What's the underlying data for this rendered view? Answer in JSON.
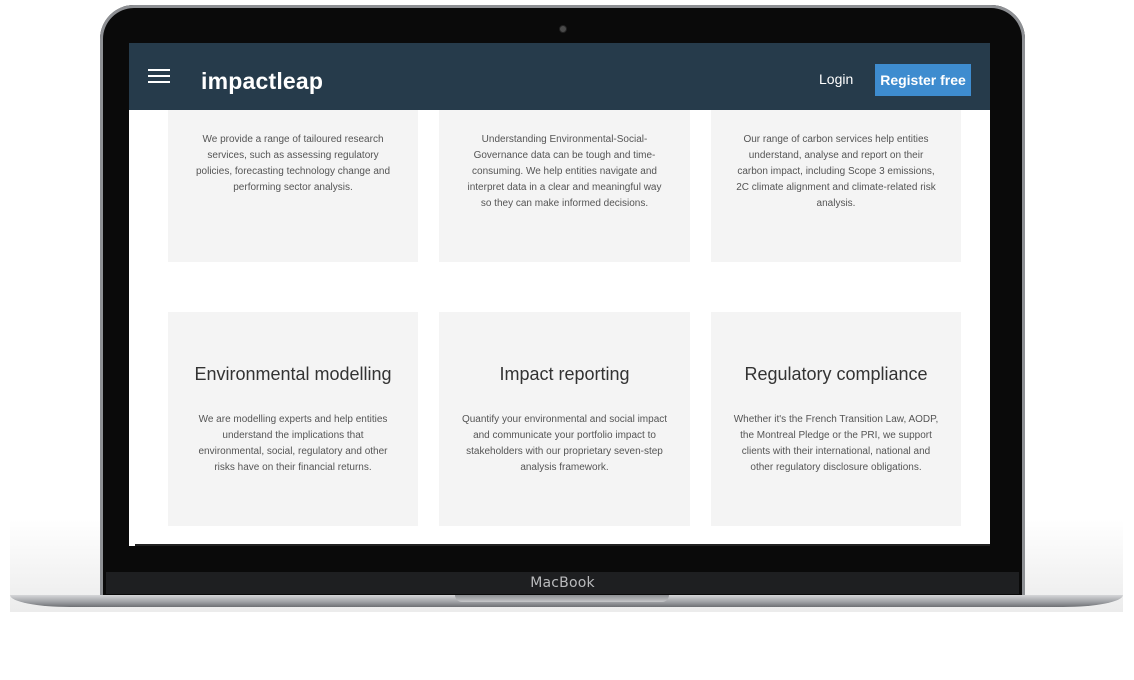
{
  "device": {
    "brand": "MacBook"
  },
  "navbar": {
    "logo": "impactleap",
    "login_label": "Login",
    "register_label": "Register free"
  },
  "cards_top": [
    {
      "text": "We provide a range of tailoured research services, such as assessing regulatory policies, forecasting technology change and performing sector analysis."
    },
    {
      "text": "Understanding Environmental-Social-Governance data can be tough and time-consuming. We help entities navigate and interpret data in a clear and meaningful way so they can make informed decisions."
    },
    {
      "text": "Our range of carbon services help entities understand, analyse and report on their carbon impact, including Scope 3 emissions, 2C climate alignment and climate-related risk analysis."
    }
  ],
  "cards_bottom": [
    {
      "title": "Environmental modelling",
      "text": "We are modelling experts and help entities understand the implications that environmental, social, regulatory and other risks have on their financial returns."
    },
    {
      "title": "Impact reporting",
      "text": "Quantify your environmental and social impact and communicate your portfolio impact to stakeholders with our proprietary seven-step analysis framework."
    },
    {
      "title": "Regulatory compliance",
      "text": "Whether it's the French Transition Law, AODP, the Montreal Pledge or the PRI, we support clients with their international, national and other regulatory disclosure obligations."
    }
  ]
}
